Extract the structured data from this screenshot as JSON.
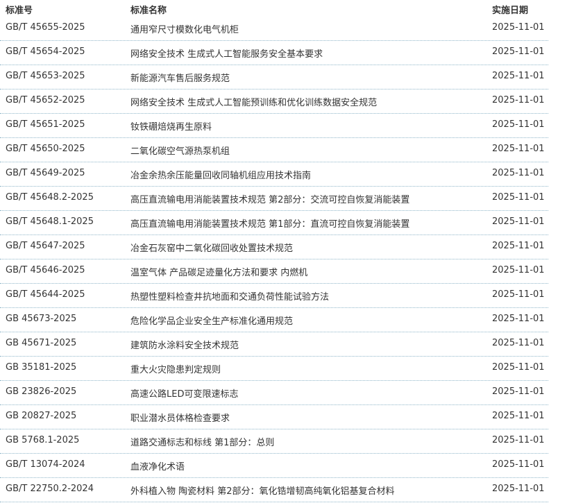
{
  "header": {
    "code_label": "标准号",
    "name_label": "标准名称",
    "date_label": "实施日期"
  },
  "rows": [
    {
      "code": "GB/T 45655-2025",
      "name": "通用窄尺寸模数化电气机柜",
      "date": "2025-11-01"
    },
    {
      "code": "GB/T 45654-2025",
      "name": "网络安全技术 生成式人工智能服务安全基本要求",
      "date": "2025-11-01"
    },
    {
      "code": "GB/T 45653-2025",
      "name": "新能源汽车售后服务规范",
      "date": "2025-11-01"
    },
    {
      "code": "GB/T 45652-2025",
      "name": "网络安全技术 生成式人工智能预训练和优化训练数据安全规范",
      "date": "2025-11-01"
    },
    {
      "code": "GB/T 45651-2025",
      "name": "钕铁硼焙烧再生原料",
      "date": "2025-11-01"
    },
    {
      "code": "GB/T 45650-2025",
      "name": "二氧化碳空气源热泵机组",
      "date": "2025-11-01"
    },
    {
      "code": "GB/T 45649-2025",
      "name": "冶金余热余压能量回收同轴机组应用技术指南",
      "date": "2025-11-01"
    },
    {
      "code": "GB/T 45648.2-2025",
      "name": "高压直流输电用消能装置技术规范 第2部分：交流可控自恢复消能装置",
      "date": "2025-11-01"
    },
    {
      "code": "GB/T 45648.1-2025",
      "name": "高压直流输电用消能装置技术规范 第1部分：直流可控自恢复消能装置",
      "date": "2025-11-01"
    },
    {
      "code": "GB/T 45647-2025",
      "name": "冶金石灰窑中二氧化碳回收处置技术规范",
      "date": "2025-11-01"
    },
    {
      "code": "GB/T 45646-2025",
      "name": "温室气体 产品碳足迹量化方法和要求 内燃机",
      "date": "2025-11-01"
    },
    {
      "code": "GB/T 45644-2025",
      "name": "热塑性塑料检查井抗地面和交通负荷性能试验方法",
      "date": "2025-11-01"
    },
    {
      "code": "GB 45673-2025",
      "name": "危险化学品企业安全生产标准化通用规范",
      "date": "2025-11-01"
    },
    {
      "code": "GB 45671-2025",
      "name": "建筑防水涂料安全技术规范",
      "date": "2025-11-01"
    },
    {
      "code": "GB 35181-2025",
      "name": "重大火灾隐患判定规则",
      "date": "2025-11-01"
    },
    {
      "code": "GB 23826-2025",
      "name": "高速公路LED可变限速标志",
      "date": "2025-11-01"
    },
    {
      "code": "GB 20827-2025",
      "name": "职业潜水员体格检查要求",
      "date": "2025-11-01"
    },
    {
      "code": "GB 5768.1-2025",
      "name": "道路交通标志和标线 第1部分：总则",
      "date": "2025-11-01"
    },
    {
      "code": "GB/T 13074-2024",
      "name": "血液净化术语",
      "date": "2025-11-01"
    },
    {
      "code": "GB/T 22750.2-2024",
      "name": "外科植入物 陶瓷材料 第2部分：氧化锆增韧高纯氧化铝基复合材料",
      "date": "2025-11-01"
    }
  ]
}
